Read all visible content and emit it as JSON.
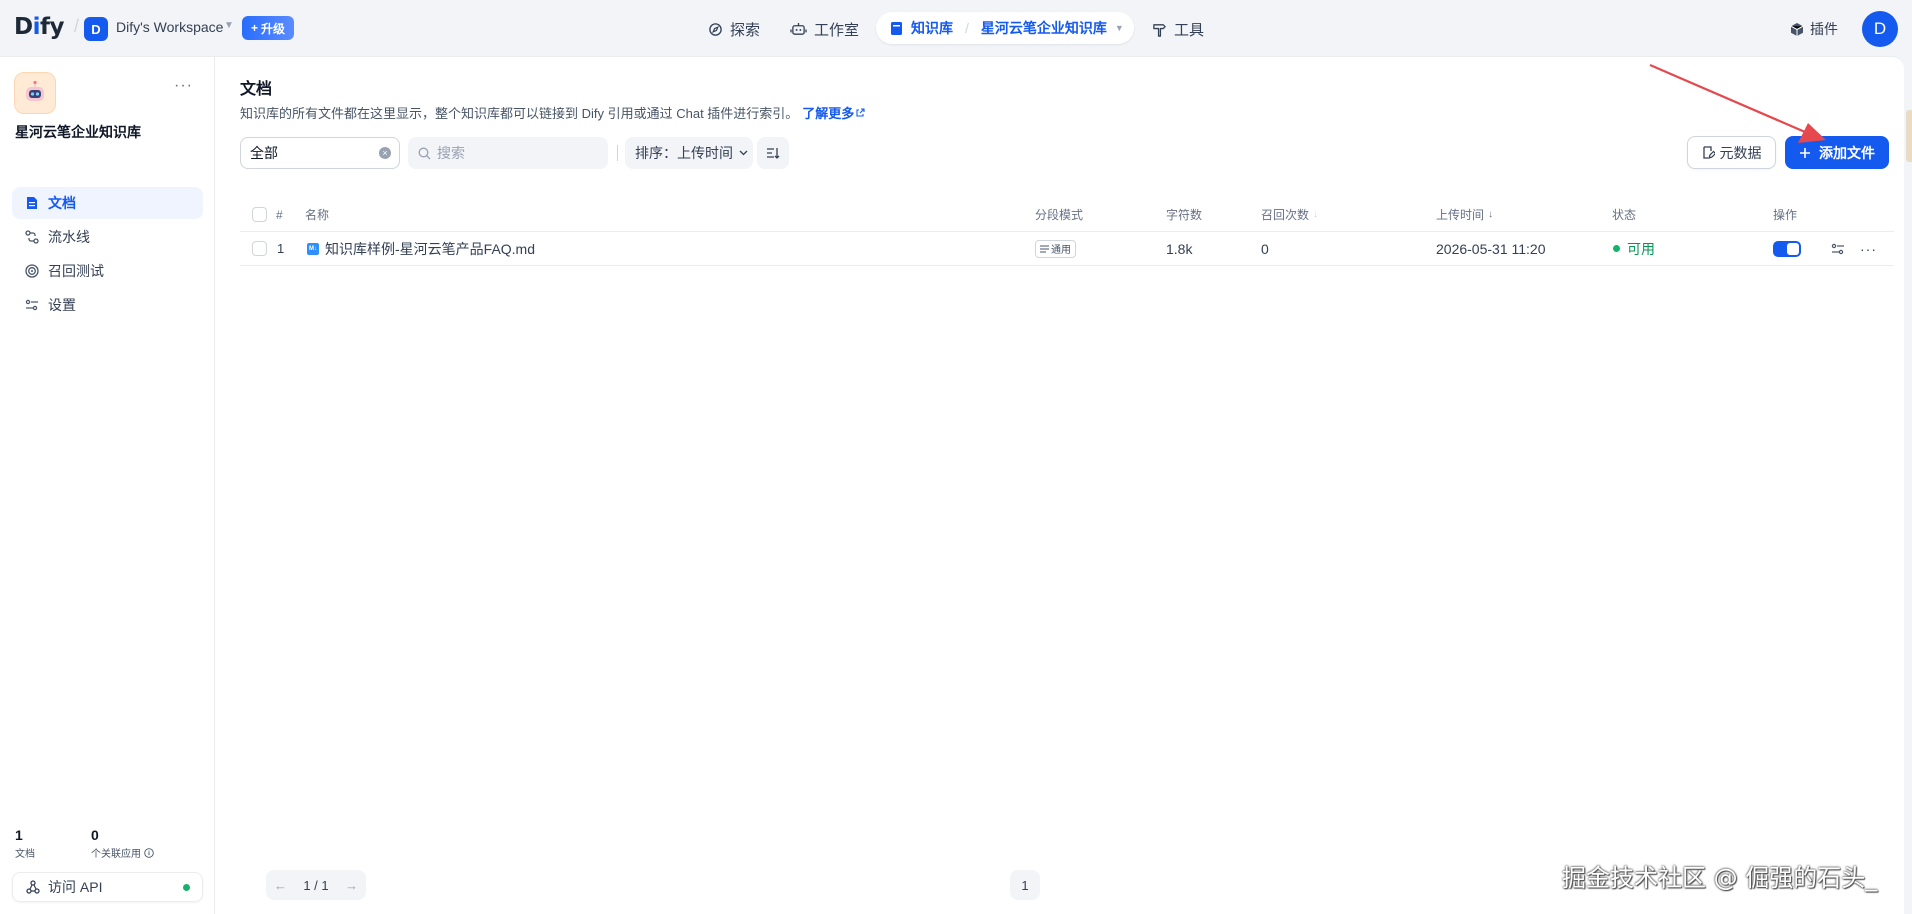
{
  "topbar": {
    "logo_prefix": "D",
    "logo_i": "i",
    "logo_suffix": "fy",
    "workspace_initial": "D",
    "workspace_name": "Dify's Workspace",
    "upgrade_label": "升级",
    "nav": {
      "explore": "探索",
      "studio": "工作室",
      "knowledge": "知识库",
      "current_kb": "星河云笔企业知识库",
      "tools": "工具"
    },
    "plugins": "插件",
    "user_initial": "D"
  },
  "sidebar": {
    "kb_name": "星河云笔企业知识库",
    "menu": [
      {
        "label": "文档",
        "icon": "document-icon"
      },
      {
        "label": "流水线",
        "icon": "pipeline-icon"
      },
      {
        "label": "召回测试",
        "icon": "target-icon"
      },
      {
        "label": "设置",
        "icon": "settings-icon"
      }
    ],
    "stats": {
      "docs_count": "1",
      "docs_label": "文档",
      "apps_count": "0",
      "apps_label": "个关联应用"
    },
    "api_label": "访问 API"
  },
  "main": {
    "title": "文档",
    "description": "知识库的所有文件都在这里显示，整个知识库都可以链接到 Dify 引用或通过 Chat 插件进行索引。",
    "learn_more": "了解更多",
    "filter_value": "全部",
    "search_placeholder": "搜索",
    "sort_label": "排序：上传时间",
    "metadata_button": "元数据",
    "add_file_button": "添加文件"
  },
  "table": {
    "headers": {
      "index": "#",
      "name": "名称",
      "mode": "分段模式",
      "chars": "字符数",
      "hits": "召回次数",
      "uploaded": "上传时间",
      "status": "状态",
      "actions": "操作"
    },
    "rows": [
      {
        "index": "1",
        "name": "知识库样例-星河云笔产品FAQ.md",
        "file_icon": "M↓",
        "mode": "通用",
        "chars": "1.8k",
        "hits": "0",
        "uploaded": "2026-05-31 11:20",
        "status": "可用",
        "enabled": true
      }
    ]
  },
  "pagination": {
    "range": "1 / 1",
    "current_page": "1"
  },
  "watermark": "掘金技术社区 @ 倔强的石头_",
  "colors": {
    "primary": "#155aef",
    "success": "#17b26a",
    "annotation_arrow": "#e5484d"
  }
}
